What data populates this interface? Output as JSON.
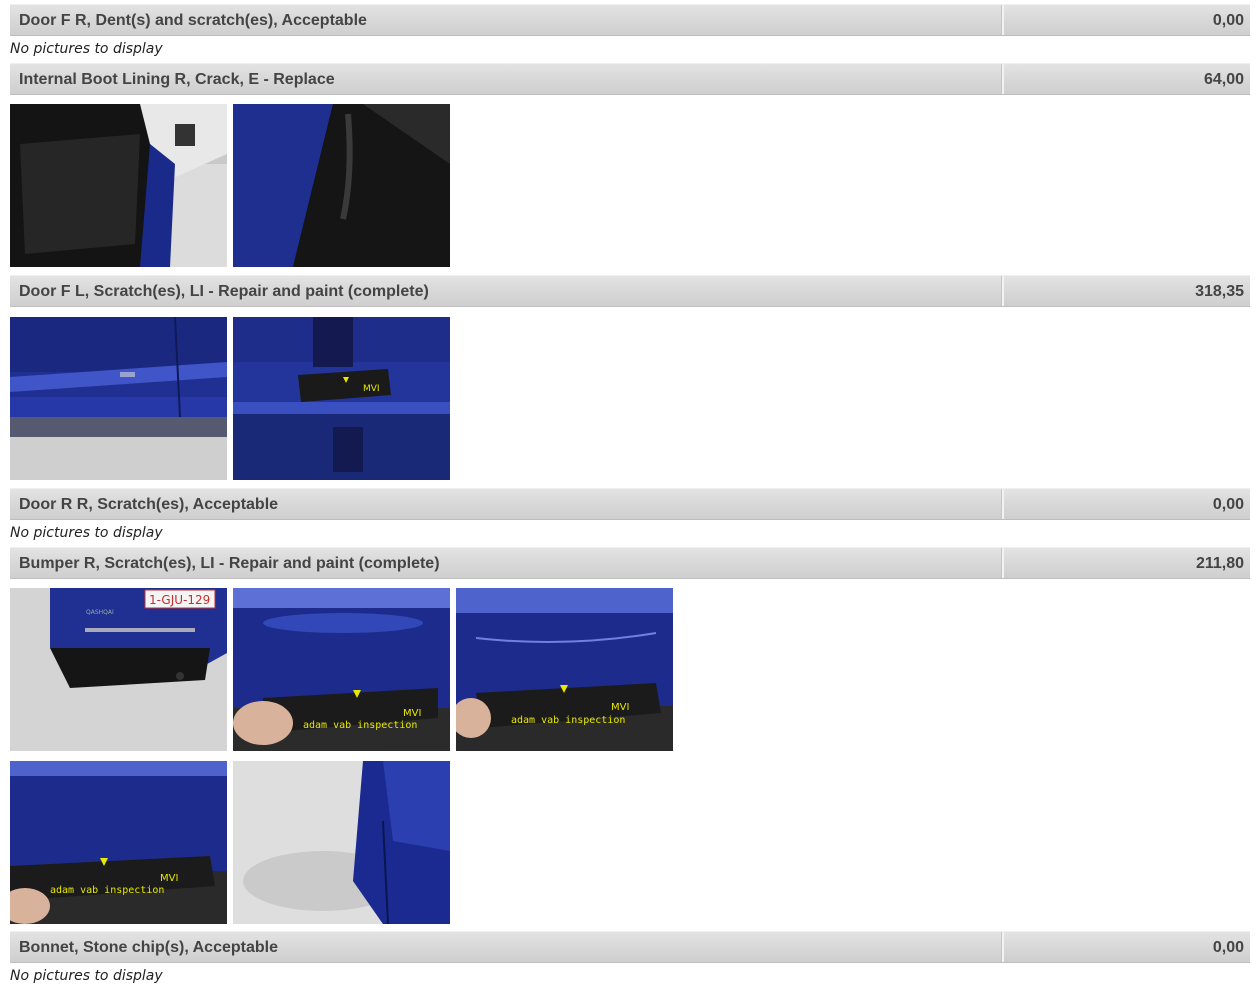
{
  "no_pictures_text": "No pictures to display",
  "items": [
    {
      "title": "Door F R, Dent(s) and scratch(es), Acceptable",
      "amount": "0,00"
    },
    {
      "title": "Internal Boot Lining R, Crack, E - Replace",
      "amount": "64,00"
    },
    {
      "title": "Door F L, Scratch(es), LI - Repair and paint (complete)",
      "amount": "318,35"
    },
    {
      "title": "Door R R, Scratch(es), Acceptable",
      "amount": "0,00"
    },
    {
      "title": "Bumper R, Scratch(es), LI - Repair and paint (complete)",
      "amount": "211,80"
    },
    {
      "title": "Bonnet, Stone chip(s), Acceptable",
      "amount": "0,00"
    }
  ],
  "photo_labels": {
    "plate": "1-GJU-129",
    "gauge_text": "adam vab inspection",
    "gauge_logo": "MVI"
  },
  "colors": {
    "header_text": "#444444",
    "car_blue": "#1f2f8f",
    "gauge_yellow": "#e8e800"
  }
}
